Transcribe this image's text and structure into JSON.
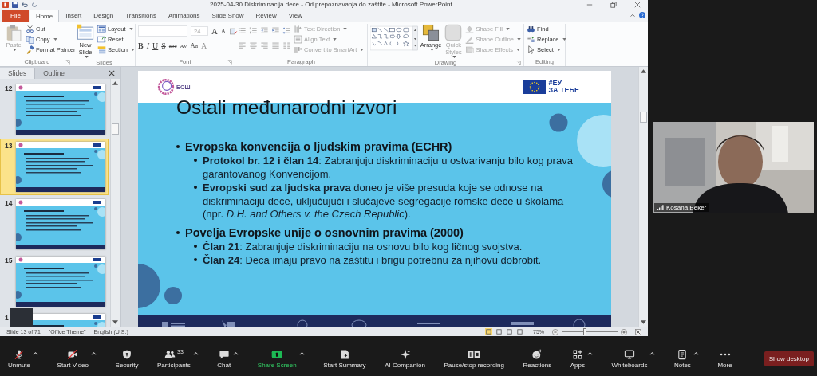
{
  "window": {
    "title": "2025-04-30 Diskriminacija dece - Od prepoznavanja do zaštite - Microsoft PowerPoint"
  },
  "ribbon_tabs": [
    {
      "label": "File",
      "kind": "file",
      "selected": false
    },
    {
      "label": "Home",
      "kind": "tab",
      "selected": true
    },
    {
      "label": "Insert",
      "kind": "tab",
      "selected": false
    },
    {
      "label": "Design",
      "kind": "tab",
      "selected": false
    },
    {
      "label": "Transitions",
      "kind": "tab",
      "selected": false
    },
    {
      "label": "Animations",
      "kind": "tab",
      "selected": false
    },
    {
      "label": "Slide Show",
      "kind": "tab",
      "selected": false
    },
    {
      "label": "Review",
      "kind": "tab",
      "selected": false
    },
    {
      "label": "View",
      "kind": "tab",
      "selected": false
    }
  ],
  "ribbon": {
    "groups": [
      {
        "label": "Clipboard",
        "kind": "plain",
        "launcher": true,
        "large": [
          {
            "label": "Paste",
            "disabled": true,
            "dropdown": true
          }
        ],
        "small": [
          {
            "label": "Cut",
            "disabled": false
          },
          {
            "label": "Copy",
            "disabled": false,
            "dropdown": true
          },
          {
            "label": "Format Painter",
            "disabled": false
          }
        ]
      },
      {
        "label": "Slides",
        "kind": "plain",
        "large": [
          {
            "label": "New Slide",
            "disabled": false,
            "dropdown": true
          }
        ],
        "small": [
          {
            "label": "Layout",
            "disabled": false,
            "dropdown": true
          },
          {
            "label": "Reset",
            "disabled": false
          },
          {
            "label": "Section",
            "disabled": false,
            "dropdown": true
          }
        ]
      },
      {
        "label": "Font",
        "kind": "font",
        "launcher": true,
        "size": "24",
        "grow_shrink": [
          "A",
          "A"
        ],
        "format": [
          "B",
          "I",
          "U",
          "S",
          "abc",
          "AV",
          "Aa",
          "A"
        ]
      },
      {
        "label": "Paragraph",
        "kind": "paragraph",
        "small": [
          {
            "label": "Text Direction",
            "disabled": true,
            "dropdown": true
          },
          {
            "label": "Align Text",
            "disabled": true,
            "dropdown": true
          },
          {
            "label": "Convert to SmartArt",
            "disabled": true,
            "dropdown": true
          }
        ]
      },
      {
        "label": "Drawing",
        "kind": "drawing",
        "launcher": true,
        "large": [
          {
            "label": "Arrange",
            "disabled": false,
            "dropdown": true
          },
          {
            "label": "Quick Styles",
            "disabled": true,
            "dropdown": true
          }
        ],
        "small": [
          {
            "label": "Shape Fill",
            "disabled": true,
            "dropdown": true
          },
          {
            "label": "Shape Outline",
            "disabled": true,
            "dropdown": true
          },
          {
            "label": "Shape Effects",
            "disabled": true,
            "dropdown": true
          }
        ]
      },
      {
        "label": "Editing",
        "kind": "plain",
        "small": [
          {
            "label": "Find",
            "disabled": false
          },
          {
            "label": "Replace",
            "disabled": false,
            "dropdown": true
          },
          {
            "label": "Select",
            "disabled": false,
            "dropdown": true
          }
        ]
      }
    ]
  },
  "pane_tabs": [
    {
      "label": "Slides",
      "selected": true
    },
    {
      "label": "Outline",
      "selected": false
    }
  ],
  "slide_thumbnails": [
    {
      "number": "12",
      "selected": false
    },
    {
      "number": "13",
      "selected": true
    },
    {
      "number": "14",
      "selected": false
    },
    {
      "number": "15",
      "selected": false
    },
    {
      "number": "1",
      "selected": false
    }
  ],
  "slide": {
    "logo_text": "БОШ",
    "badge_lines": [
      "#ЕУ",
      "ЗА ТЕБЕ"
    ],
    "title": "Ostali međunarodni izvori",
    "bullets": [
      {
        "text": "Evropska konvencija o ljudskim pravima (ECHR)",
        "children": [
          {
            "text": "**Protokol br. 12 i član 14**: Zabranjuju diskriminaciju u ostvarivanju bilo kog prava garantovanog Konvencijom."
          },
          {
            "text": "**Evropski sud za ljudska prava** doneo je više presuda koje se odnose na diskriminaciju dece, uključujući i slučajeve segregacije romske dece u školama (npr. *D.H. and Others v. the Czech Republic*)."
          }
        ]
      },
      {
        "text": "Povelja Evropske unije o osnovnim pravima (2000)",
        "children": [
          {
            "text": "**Član 21**: Zabranjuje diskriminaciju na osnovu bilo kog ličnog svojstva."
          },
          {
            "text": "**Član 24**: Deca imaju pravo na zaštitu i brigu potrebnu za njihovu dobrobit."
          }
        ]
      }
    ]
  },
  "status_bar": {
    "slide": "Slide 13 of 71",
    "theme": "\"Office Theme\"",
    "language": "English (U.S.)",
    "views": [
      {
        "selected": true
      },
      {
        "selected": false
      },
      {
        "selected": false
      },
      {
        "selected": false
      }
    ],
    "zoom": "75%",
    "zoom_slider": {
      "level": 0.42
    }
  },
  "video_tile": {
    "name": "Kosana Beker"
  },
  "meeting_toolbar": {
    "items": [
      {
        "label": "Unmute",
        "caret": true,
        "highlighted": false
      },
      {
        "label": "Start Video",
        "caret": true,
        "highlighted": false
      },
      {
        "label": "Security",
        "highlighted": false
      },
      {
        "label": "Participants",
        "count": "33",
        "caret": true,
        "highlighted": false
      },
      {
        "label": "Chat",
        "caret": true,
        "highlighted": false
      },
      {
        "label": "Share Screen",
        "caret": true,
        "highlighted": true
      },
      {
        "label": "Start Summary",
        "highlighted": false
      },
      {
        "label": "AI Companion",
        "highlighted": false
      },
      {
        "label": "Pause/stop recording",
        "highlighted": false
      },
      {
        "label": "Reactions",
        "highlighted": false
      },
      {
        "label": "Apps",
        "caret": true,
        "highlighted": false
      },
      {
        "label": "Whiteboards",
        "caret": true,
        "highlighted": false
      },
      {
        "label": "Notes",
        "caret": true,
        "highlighted": false
      },
      {
        "label": "More",
        "highlighted": false
      }
    ],
    "show_desktop": "Show desktop"
  }
}
